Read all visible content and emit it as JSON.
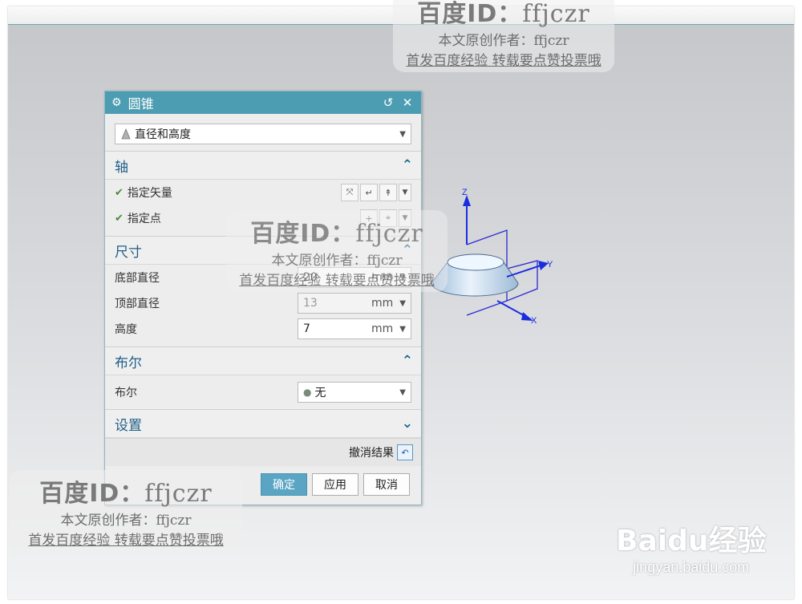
{
  "dialog": {
    "title": "圆锥",
    "type_value": "直径和高度",
    "axis": {
      "header": "轴",
      "vector_label": "指定矢量",
      "point_label": "指定点"
    },
    "dims": {
      "header": "尺寸",
      "base_label": "底部直径",
      "base_value": "20",
      "top_label": "顶部直径",
      "top_value": "13",
      "height_label": "高度",
      "height_value": "7",
      "unit": "mm"
    },
    "boolean": {
      "header": "布尔",
      "label": "布尔",
      "value": "无"
    },
    "settings_header": "设置",
    "undo_label": "撤消结果",
    "ok": "确定",
    "apply": "应用",
    "cancel": "取消"
  },
  "axes": {
    "z": "Z",
    "y": "Y",
    "x": "X"
  },
  "watermark": {
    "big": "百度ID：",
    "id": "ffjczr",
    "line2": "本文原创作者：ffjczr",
    "line3": "首发百度经验 转载要点赞投票哦"
  },
  "baidu_logo": {
    "brand": "Baidu经验",
    "url": "jingyan.baidu.com"
  }
}
